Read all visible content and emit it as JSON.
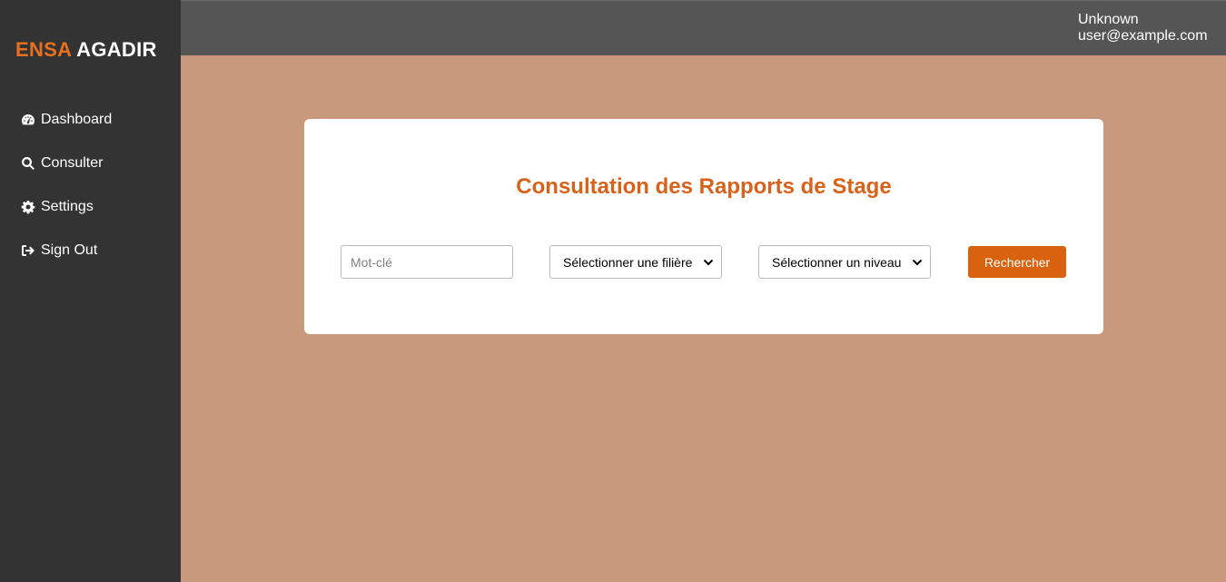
{
  "brand": {
    "accent": "ENSA",
    "rest": "AGADIR"
  },
  "sidebar": {
    "items": [
      {
        "label": "Dashboard",
        "icon": "dashboard-gauge-icon"
      },
      {
        "label": "Consulter",
        "icon": "search-icon"
      },
      {
        "label": "Settings",
        "icon": "gear-icon"
      },
      {
        "label": "Sign Out",
        "icon": "sign-out-icon"
      }
    ]
  },
  "header": {
    "user_name": "Unknown",
    "user_email": "user@example.com"
  },
  "main": {
    "title": "Consultation des Rapports de Stage",
    "keyword": {
      "placeholder": "Mot-clé",
      "value": ""
    },
    "filiere_select": {
      "selected": "Sélectionner une filière"
    },
    "niveau_select": {
      "selected": "Sélectionner un niveau"
    },
    "search_button": "Rechercher"
  },
  "colors": {
    "sidebar_bg": "#333333",
    "topbar_bg": "#555555",
    "page_bg": "#c9997d",
    "accent": "#d9621a",
    "button_bg": "#d9620f"
  }
}
